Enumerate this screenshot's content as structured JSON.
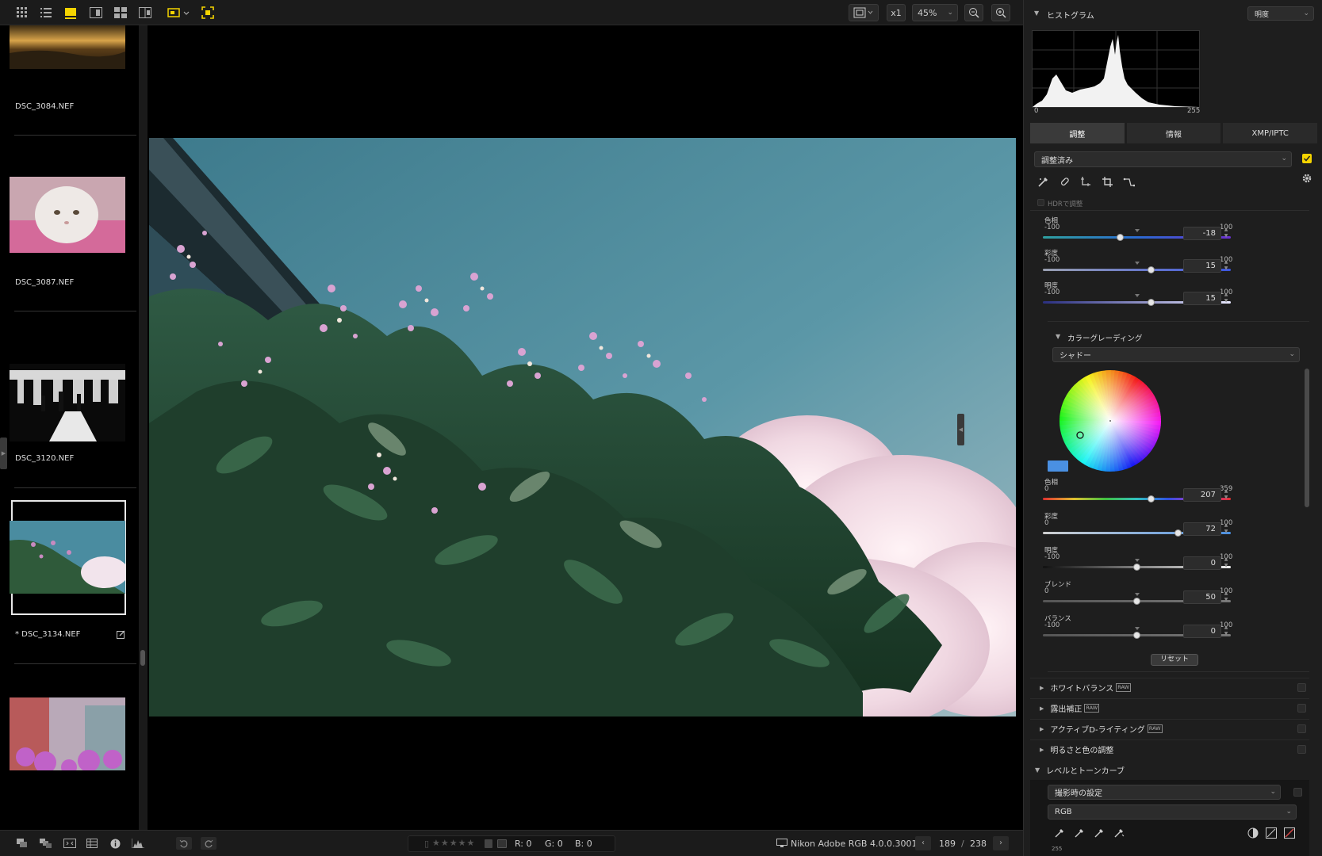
{
  "toolbar": {
    "zoom_multiplier": "x1",
    "zoom_percent": "45%"
  },
  "filmstrip": {
    "items": [
      {
        "filename": "DSC_3084.NEF"
      },
      {
        "filename": "DSC_3087.NEF"
      },
      {
        "filename": "DSC_3120.NEF"
      },
      {
        "filename": "* DSC_3134.NEF",
        "selected": true
      },
      {
        "filename": ""
      }
    ]
  },
  "statusbar": {
    "rgb_r": "R: 0",
    "rgb_g": "G: 0",
    "rgb_b": "B: 0",
    "color_profile": "Nikon Adobe RGB 4.0.0.3001",
    "current_index": "189",
    "separator": "/",
    "total": "238"
  },
  "panel": {
    "histogram": {
      "title": "ヒストグラム",
      "channel": "明度",
      "axis_min": "0",
      "axis_max": "255"
    },
    "tabs": [
      "調整",
      "情報",
      "XMP/IPTC"
    ],
    "preset_select": "調整済み",
    "hdr_label": "HDRで調整",
    "top_sliders": [
      {
        "label": "色相",
        "min": "-100",
        "max": "100",
        "value": "-18",
        "pos": 0.41
      },
      {
        "label": "彩度",
        "min": "-100",
        "max": "100",
        "value": "15",
        "pos": 0.575
      },
      {
        "label": "明度",
        "min": "-100",
        "max": "100",
        "value": "15",
        "pos": 0.575
      }
    ],
    "color_grading": {
      "title": "カラーグレーディング",
      "range_select": "シャドー",
      "accent_color": "#4a90e2",
      "sliders": [
        {
          "label": "色相",
          "min": "0",
          "max": "359",
          "value": "207",
          "pos": 0.577
        },
        {
          "label": "彩度",
          "min": "0",
          "max": "100",
          "value": "72",
          "pos": 0.72
        },
        {
          "label": "明度",
          "min": "-100",
          "max": "100",
          "value": "0",
          "pos": 0.5
        },
        {
          "label": "ブレンド",
          "min": "0",
          "max": "100",
          "value": "50",
          "pos": 0.5
        },
        {
          "label": "バランス",
          "min": "-100",
          "max": "100",
          "value": "0",
          "pos": 0.5
        }
      ],
      "reset_label": "リセット"
    },
    "sections": [
      {
        "label": "ホワイトバランス",
        "raw": "RAW"
      },
      {
        "label": "露出補正",
        "raw": "RAW"
      },
      {
        "label": "アクティブD-ライティング",
        "raw": "RAW"
      },
      {
        "label": "明るさと色の調整",
        "raw": ""
      }
    ],
    "levels": {
      "title": "レベルとトーンカーブ",
      "preset": "撮影時の設定",
      "channel": "RGB",
      "bottom_value": "255"
    }
  }
}
